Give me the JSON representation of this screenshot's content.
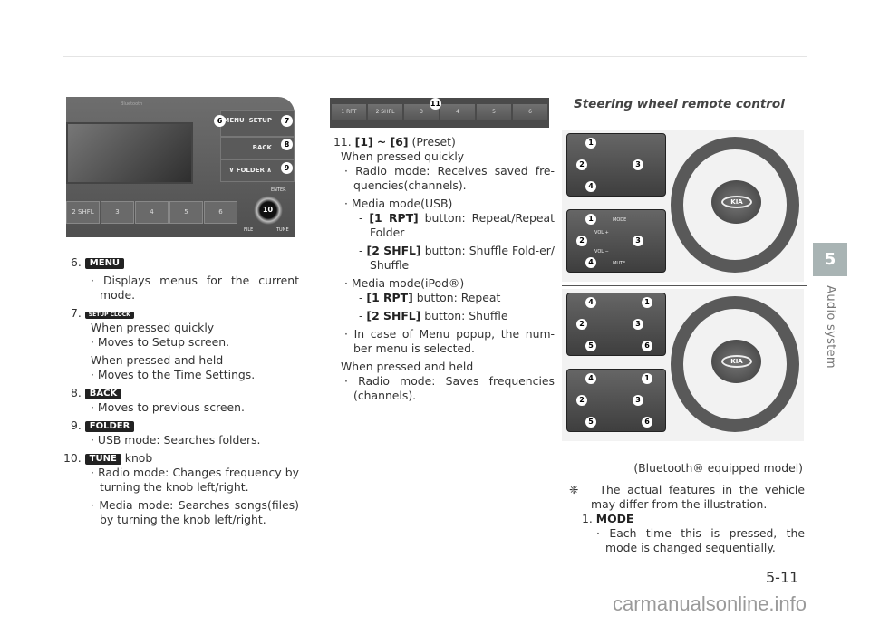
{
  "section": {
    "number": "5",
    "title": "Audio system"
  },
  "page_number": "5-11",
  "watermark": "carmanualsonline.info",
  "radio_image": {
    "labels": {
      "menu": "MENU",
      "setup": "SETUP",
      "clock": "CLOCK",
      "back": "BACK",
      "folder": "∨ FOLDER ∧",
      "enter": "ENTER",
      "file": "FILE",
      "tune": "TUNE",
      "bluetooth": "Bluetooth"
    },
    "presets": [
      "2 SHFL",
      "3",
      "4",
      "5",
      "6"
    ],
    "callouts": [
      "6",
      "7",
      "8",
      "9",
      "10"
    ]
  },
  "preset_image": {
    "buttons": [
      "1 RPT",
      "2 SHFL",
      "3",
      "4",
      "5",
      "6"
    ],
    "callout": "11"
  },
  "left": {
    "items": [
      {
        "num": "6.",
        "key": "MENU",
        "bullets": [
          "Displays menus for the current mode."
        ]
      },
      {
        "num": "7.",
        "key": "SETUP CLOCK",
        "sub1": "When pressed quickly",
        "b1": "Moves to Setup screen.",
        "sub2": "When pressed and held",
        "b2": "Moves to the Time Settings."
      },
      {
        "num": "8.",
        "key": "BACK",
        "bullets": [
          "Moves to previous screen."
        ]
      },
      {
        "num": "9.",
        "key": "FOLDER",
        "bullets": [
          "USB mode: Searches folders."
        ]
      },
      {
        "num": "10.",
        "key": "TUNE",
        "suffix": "knob",
        "bullets": [
          "Radio mode: Changes frequency by turning the knob left/right.",
          "Media mode: Searches songs(files) by turning the knob left/right."
        ]
      }
    ]
  },
  "middle": {
    "num": "11.",
    "key": "[1] ~ [6]",
    "suffix": "(Preset)",
    "quick": "When pressed quickly",
    "radio": "Radio mode: Receives saved fre-quencies(channels).",
    "usb": "Media mode(USB)",
    "rpt_key": "[1 RPT]",
    "rpt_usb": "button: Repeat/Repeat Folder",
    "shfl_key": "[2 SHFL]",
    "shfl_usb": "button: Shuffle Fold-er/ Shuffle",
    "ipod": "Media mode(iPod®)",
    "rpt_ipod": "button: Repeat",
    "shfl_ipod": "button: Shuffle",
    "popup": "In case of Menu popup, the num-ber menu is selected.",
    "held": "When pressed and held",
    "held_radio": "Radio mode: Saves frequencies (channels)."
  },
  "right": {
    "heading": "Steering wheel remote control",
    "caption": "(Bluetooth® equipped model)",
    "note_symbol": "❈",
    "note": "The actual features in the vehicle may differ from the illustration.",
    "item_num": "1.",
    "item_key": "MODE",
    "item_bullet": "Each time this is pressed, the mode is changed sequentially.",
    "image_labels": {
      "mode": "MODE",
      "mute": "MUTE",
      "vol_up": "VOL +",
      "vol_down": "VOL −",
      "logo": "KIA"
    }
  }
}
